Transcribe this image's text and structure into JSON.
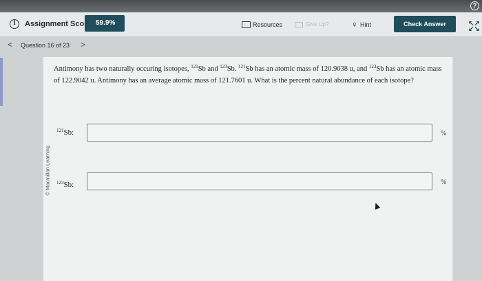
{
  "toolbar": {
    "score_label": "Assignment Score:",
    "score_value": "59.9%",
    "resources_label": "Resources",
    "giveup_label": "Give Up?",
    "hint_label": "Hint",
    "check_label": "Check Answer"
  },
  "nav": {
    "counter": "Question 16 of 23",
    "prev_glyph": "<",
    "next_glyph": ">"
  },
  "copyright": "© Macmillan Learning",
  "question": {
    "p1": "Antimony has two naturally occuring isotopes, ",
    "sup1": "121",
    "p2": "Sb and ",
    "sup2": "123",
    "p3": "Sb. ",
    "sup3": "121",
    "p4": "Sb has an atomic mass of 120.9038 u, and ",
    "sup4": "123",
    "p5": "Sb has an atomic mass of 122.9042 u. Antimony has an average atomic mass of 121.7601 u. What is the percent natural abundance of each isotope?"
  },
  "answers": [
    {
      "mass": "121",
      "symbol": "Sb:",
      "value": "",
      "unit": "%"
    },
    {
      "mass": "123",
      "symbol": "Sb:",
      "value": "",
      "unit": "%"
    }
  ],
  "colors": {
    "accent": "#1f4d5b",
    "left_accent": "#8f98c8"
  }
}
